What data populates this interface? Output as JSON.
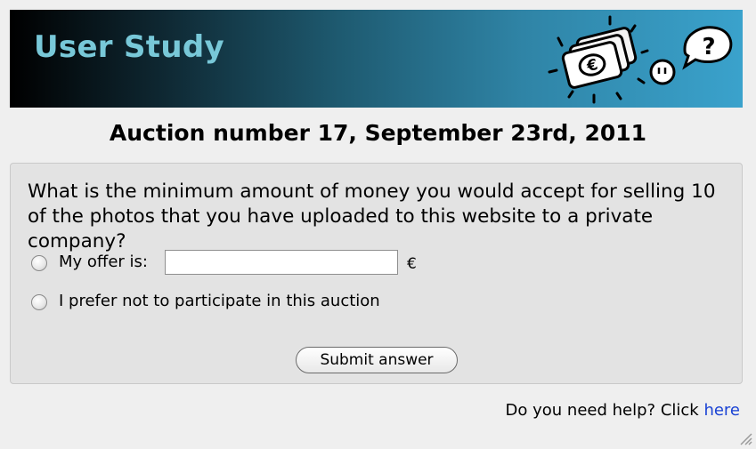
{
  "banner": {
    "title": "User Study",
    "title_color": "#78c8d8",
    "art_icons": [
      "money-bills-icon",
      "face-icon",
      "question-bubble-icon"
    ],
    "currency_symbol": "€",
    "speech_symbol": "?"
  },
  "auction": {
    "title": "Auction number 17, September 23rd, 2011"
  },
  "form": {
    "question": "What is the minimum amount of money you would accept for selling 10 of the photos that you have uploaded to this website to a private company?",
    "option_offer_label": "My offer is:",
    "offer_value": "",
    "currency": "€",
    "option_decline_label": "I prefer not to participate in this auction",
    "submit_label": "Submit answer"
  },
  "help": {
    "prefix": "Do you need help? Click ",
    "link_text": "here",
    "link_color": "#1a43d4"
  }
}
